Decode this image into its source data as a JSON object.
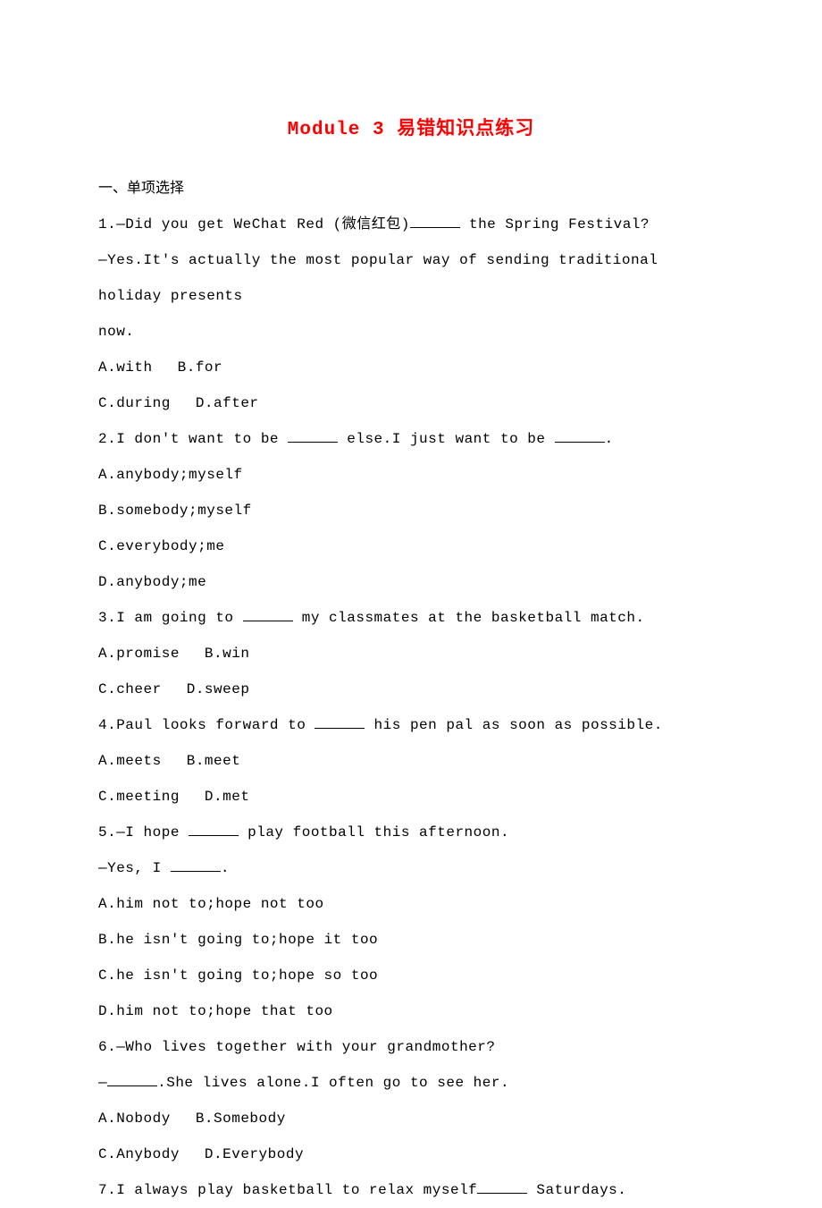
{
  "title": "Module 3 易错知识点练习",
  "sectionHeader": "一、单项选择",
  "questions": [
    {
      "num": "1.",
      "lines": [
        {
          "pre": "—Did you get WeChat Red (微信红包)",
          "blank": true,
          "post": " the Spring Festival?"
        },
        {
          "pre": "—Yes.It's actually the most popular way of sending traditional holiday presents",
          "blank": false,
          "post": ""
        },
        {
          "pre": "now.",
          "blank": false,
          "post": ""
        }
      ],
      "optionRows": [
        [
          {
            "label": "A.with"
          },
          {
            "label": "B.for"
          }
        ],
        [
          {
            "label": "C.during"
          },
          {
            "label": "D.after"
          }
        ]
      ]
    },
    {
      "num": "2.",
      "lines": [
        {
          "pre": "I don't want to be ",
          "blank": true,
          "post": " else.I just want to be ",
          "blank2": true,
          "post2": "."
        }
      ],
      "optionRows": [
        [
          {
            "label": "A.anybody;myself"
          }
        ],
        [
          {
            "label": "B.somebody;myself"
          }
        ],
        [
          {
            "label": "C.everybody;me"
          }
        ],
        [
          {
            "label": "D.anybody;me"
          }
        ]
      ]
    },
    {
      "num": "3.",
      "lines": [
        {
          "pre": "I am going to ",
          "blank": true,
          "post": " my classmates at the basketball match."
        }
      ],
      "optionRows": [
        [
          {
            "label": "A.promise"
          },
          {
            "label": "B.win"
          }
        ],
        [
          {
            "label": "C.cheer"
          },
          {
            "label": "D.sweep"
          }
        ]
      ]
    },
    {
      "num": "4.",
      "lines": [
        {
          "pre": "Paul looks forward to ",
          "blank": true,
          "post": " his pen pal as soon as possible."
        }
      ],
      "optionRows": [
        [
          {
            "label": "A.meets"
          },
          {
            "label": "B.meet"
          }
        ],
        [
          {
            "label": "C.meeting"
          },
          {
            "label": "D.met"
          }
        ]
      ]
    },
    {
      "num": "5.",
      "lines": [
        {
          "pre": "—I hope ",
          "blank": true,
          "post": " play football this afternoon."
        },
        {
          "pre": "—Yes, I ",
          "blank": true,
          "post": "."
        }
      ],
      "optionRows": [
        [
          {
            "label": "A.him not to;hope not too"
          }
        ],
        [
          {
            "label": "B.he isn't going to;hope it too"
          }
        ],
        [
          {
            "label": "C.he isn't going to;hope so too"
          }
        ],
        [
          {
            "label": "D.him not to;hope that too"
          }
        ]
      ]
    },
    {
      "num": "6.",
      "lines": [
        {
          "pre": "—Who lives together with your grandmother?",
          "blank": false,
          "post": ""
        },
        {
          "pre": "—",
          "blank": true,
          "post": ".She lives alone.I often go to see her."
        }
      ],
      "optionRows": [
        [
          {
            "label": "A.Nobody"
          },
          {
            "label": "B.Somebody"
          }
        ],
        [
          {
            "label": "C.Anybody"
          },
          {
            "label": "D.Everybody"
          }
        ]
      ]
    },
    {
      "num": "7.",
      "lines": [
        {
          "pre": "I always play basketball to relax myself",
          "blank": true,
          "post": " Saturdays."
        }
      ],
      "optionRows": []
    }
  ]
}
